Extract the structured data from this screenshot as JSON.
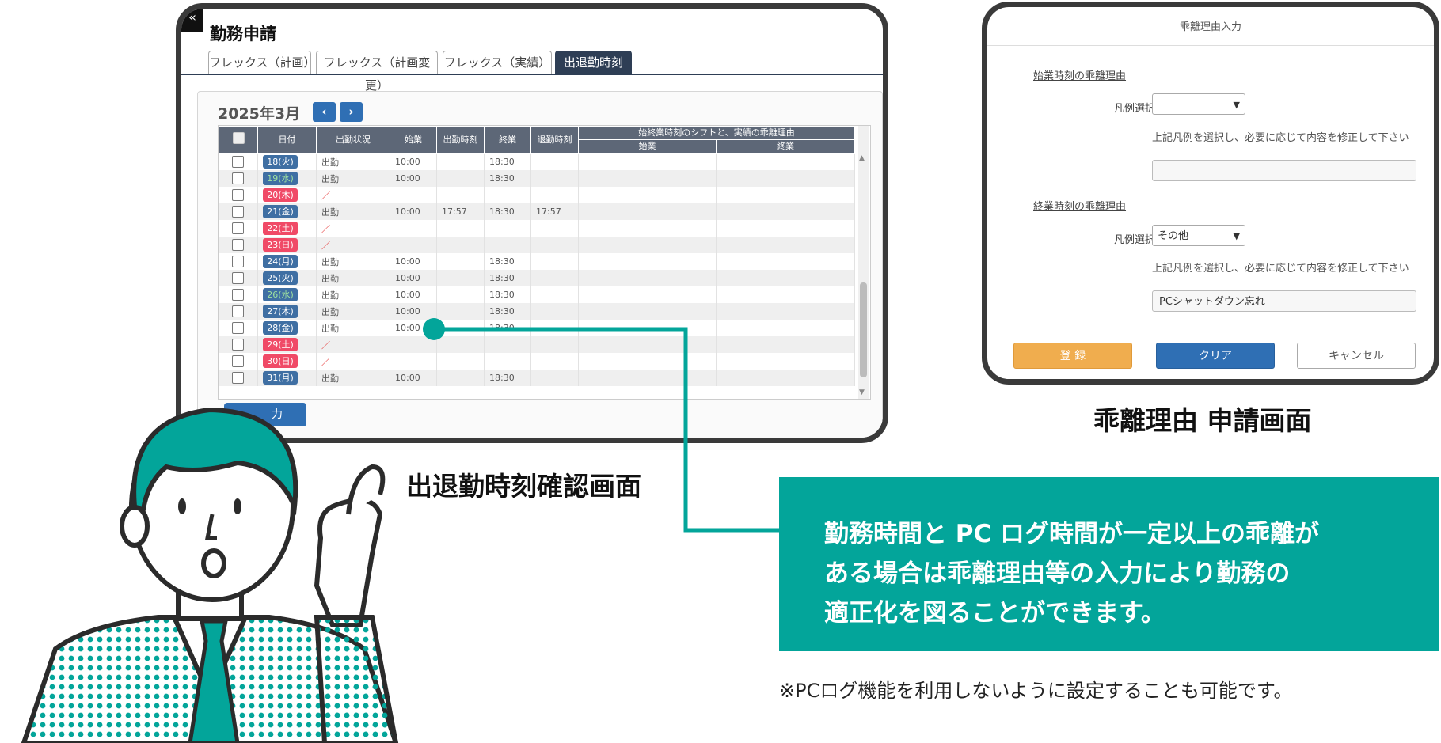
{
  "attendance_screen": {
    "title": "勤務申請",
    "tabs": [
      {
        "label": "フレックス（計画）",
        "active": false
      },
      {
        "label": "フレックス（計画変更）",
        "active": false
      },
      {
        "label": "フレックス（実績）",
        "active": false
      },
      {
        "label": "出退勤時刻",
        "active": true
      }
    ],
    "month_label": "2025年3月",
    "prev_icon": "chevron-left-icon",
    "next_icon": "chevron-right-icon",
    "columns": {
      "date": "日付",
      "status": "出勤状況",
      "start": "始業",
      "clock_in": "出勤時刻",
      "end": "終業",
      "clock_out": "退勤時刻",
      "reason_group": "始終業時刻のシフトと、実績の乖離理由",
      "reason_start": "始業",
      "reason_end": "終業"
    },
    "rows": [
      {
        "date": "18(火)",
        "kind": "weekday",
        "status": "出勤",
        "start": "10:00",
        "clock_in": "",
        "end": "18:30",
        "clock_out": "",
        "late": false
      },
      {
        "date": "19(水)",
        "kind": "wed",
        "status": "出勤",
        "start": "10:00",
        "clock_in": "",
        "end": "18:30",
        "clock_out": "",
        "late": false
      },
      {
        "date": "20(木)",
        "kind": "holiday",
        "status": "／",
        "start": "",
        "clock_in": "",
        "end": "",
        "clock_out": "",
        "late": false
      },
      {
        "date": "21(金)",
        "kind": "weekday",
        "status": "出勤",
        "start": "10:00",
        "clock_in": "17:57",
        "end": "18:30",
        "clock_out": "17:57",
        "late": true
      },
      {
        "date": "22(土)",
        "kind": "holiday",
        "status": "／",
        "start": "",
        "clock_in": "",
        "end": "",
        "clock_out": "",
        "late": false
      },
      {
        "date": "23(日)",
        "kind": "holiday",
        "status": "／",
        "start": "",
        "clock_in": "",
        "end": "",
        "clock_out": "",
        "late": false
      },
      {
        "date": "24(月)",
        "kind": "weekday",
        "status": "出勤",
        "start": "10:00",
        "clock_in": "",
        "end": "18:30",
        "clock_out": "",
        "late": false
      },
      {
        "date": "25(火)",
        "kind": "weekday",
        "status": "出勤",
        "start": "10:00",
        "clock_in": "",
        "end": "18:30",
        "clock_out": "",
        "late": false
      },
      {
        "date": "26(水)",
        "kind": "wed",
        "status": "出勤",
        "start": "10:00",
        "clock_in": "",
        "end": "18:30",
        "clock_out": "",
        "late": false
      },
      {
        "date": "27(木)",
        "kind": "weekday",
        "status": "出勤",
        "start": "10:00",
        "clock_in": "",
        "end": "18:30",
        "clock_out": "",
        "late": false
      },
      {
        "date": "28(金)",
        "kind": "weekday",
        "status": "出勤",
        "start": "10:00",
        "clock_in": "",
        "end": "18:30",
        "clock_out": "",
        "late": false
      },
      {
        "date": "29(土)",
        "kind": "holiday",
        "status": "／",
        "start": "",
        "clock_in": "",
        "end": "",
        "clock_out": "",
        "late": false
      },
      {
        "date": "30(日)",
        "kind": "holiday",
        "status": "／",
        "start": "",
        "clock_in": "",
        "end": "",
        "clock_out": "",
        "late": false
      },
      {
        "date": "31(月)",
        "kind": "weekday",
        "status": "出勤",
        "start": "10:00",
        "clock_in": "",
        "end": "18:30",
        "clock_out": "",
        "late": false
      }
    ],
    "output_button": "力"
  },
  "deviation_dialog": {
    "title": "乖離理由入力",
    "start_section": "始業時刻の乖離理由",
    "end_section": "終業時刻の乖離理由",
    "preset_label": "凡例選択",
    "start_preset_value": "",
    "end_preset_value": "その他",
    "hint": "上記凡例を選択し、必要に応じて内容を修正して下さい",
    "start_reason_value": "",
    "end_reason_value": "PCシャットダウン忘れ",
    "register_button": "登 録",
    "clear_button": "クリア",
    "cancel_button": "キャンセル"
  },
  "captions": {
    "attendance": "出退勤時刻確認画面",
    "deviation": "乖離理由 申請画面"
  },
  "callout": {
    "lines": [
      "勤務時間と PC ログ時間が一定以上の乖離が",
      "ある場合は乖離理由等の入力により勤務の",
      "適正化を図ることができます。"
    ]
  },
  "footnote": "※PCログ機能を利用しないように設定することも可能です。",
  "colors": {
    "accent_teal": "#03a59a",
    "primary_blue": "#2f6fb4",
    "register_orange": "#f0ad4e",
    "holiday_red": "#f04a67",
    "header_navy": "#2e3e55"
  }
}
